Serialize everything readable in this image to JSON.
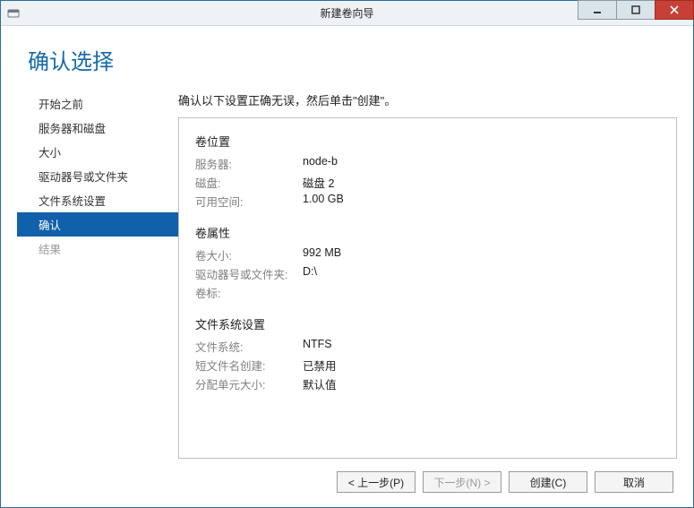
{
  "window": {
    "title": "新建卷向导"
  },
  "heading": "确认选择",
  "sidebar": {
    "items": [
      {
        "label": "开始之前"
      },
      {
        "label": "服务器和磁盘"
      },
      {
        "label": "大小"
      },
      {
        "label": "驱动器号或文件夹"
      },
      {
        "label": "文件系统设置"
      },
      {
        "label": "确认"
      },
      {
        "label": "结果"
      }
    ],
    "active_index": 5,
    "disabled_index": 6
  },
  "instruction": "确认以下设置正确无误，然后单击\"创建\"。",
  "panel": {
    "location": {
      "title": "卷位置",
      "server_label": "服务器:",
      "server_value": "node-b",
      "disk_label": "磁盘:",
      "disk_value": "磁盘 2",
      "free_label": "可用空间:",
      "free_value": "1.00 GB"
    },
    "properties": {
      "title": "卷属性",
      "size_label": "卷大小:",
      "size_value": "992 MB",
      "drive_label": "驱动器号或文件夹:",
      "drive_value": "D:\\",
      "vlabel_label": "卷标:",
      "vlabel_value": ""
    },
    "filesystem": {
      "title": "文件系统设置",
      "fs_label": "文件系统:",
      "fs_value": "NTFS",
      "short_label": "短文件名创建:",
      "short_value": "已禁用",
      "alloc_label": "分配单元大小:",
      "alloc_value": "默认值"
    }
  },
  "footer": {
    "prev": "< 上一步(P)",
    "next": "下一步(N) >",
    "create": "创建(C)",
    "cancel": "取消"
  }
}
